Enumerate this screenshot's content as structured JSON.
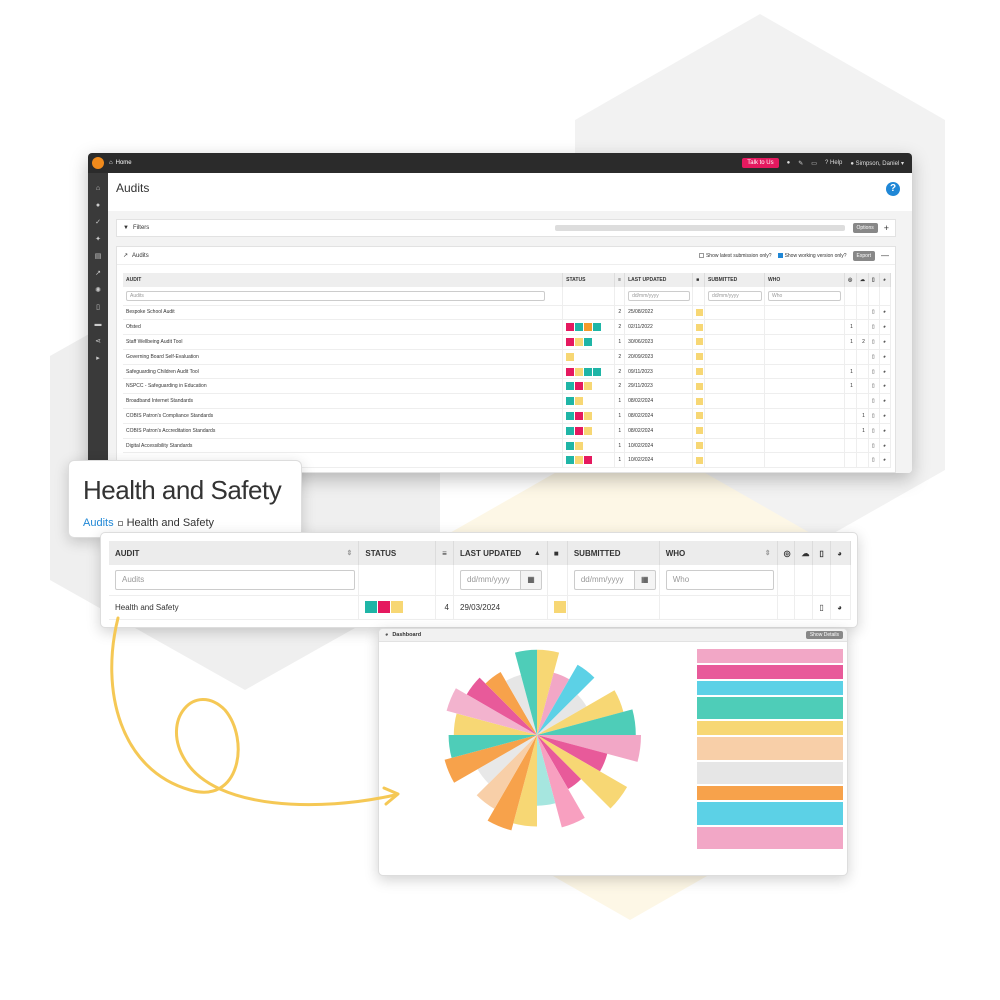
{
  "topbar": {
    "home_label": "Home",
    "talk_label": "Talk to Us",
    "help_label": "Help",
    "user_label": "Simpson, Daniel"
  },
  "page": {
    "title": "Audits"
  },
  "filters": {
    "label": "Filters",
    "options_label": "Options"
  },
  "audits_panel": {
    "label": "Audits",
    "latest_only_label": "Show latest submission only?",
    "working_version_label": "Show working version only?",
    "export_label": "Export",
    "columns": [
      "AUDIT",
      "STATUS",
      "LAST UPDATED",
      "SUBMITTED",
      "WHO"
    ],
    "filter_placeholders": {
      "audit": "Audits",
      "date": "dd/mm/yyyy",
      "who": "Who"
    },
    "rows": [
      {
        "name": "Bespoke School Audit",
        "status": [],
        "count": "2",
        "updated": "25/08/2022",
        "c1": "",
        "c2": ""
      },
      {
        "name": "Ofsted",
        "status": [
          "pink",
          "teal",
          "orange",
          "teal"
        ],
        "count": "2",
        "updated": "02/11/2022",
        "c1": "1",
        "c2": ""
      },
      {
        "name": "Staff Wellbeing Audit Tool",
        "status": [
          "pink",
          "yellow",
          "teal"
        ],
        "count": "1",
        "updated": "30/06/2023",
        "c1": "1",
        "c2": "2"
      },
      {
        "name": "Governing Board Self-Evaluation",
        "status": [
          "yellow"
        ],
        "count": "2",
        "updated": "20/09/2023",
        "c1": "",
        "c2": ""
      },
      {
        "name": "Safeguarding Children Audit Tool",
        "status": [
          "pink",
          "yellow",
          "teal",
          "teal"
        ],
        "count": "2",
        "updated": "09/11/2023",
        "c1": "1",
        "c2": ""
      },
      {
        "name": "NSPCC - Safeguarding in Education",
        "status": [
          "teal",
          "pink",
          "yellow"
        ],
        "count": "2",
        "updated": "29/11/2023",
        "c1": "1",
        "c2": ""
      },
      {
        "name": "Broadband Internet Standards",
        "status": [
          "teal",
          "yellow"
        ],
        "count": "1",
        "updated": "08/02/2024",
        "c1": "",
        "c2": ""
      },
      {
        "name": "COBIS Patron's Compliance Standards",
        "status": [
          "teal",
          "pink",
          "yellow"
        ],
        "count": "1",
        "updated": "08/02/2024",
        "c1": "",
        "c2": "1"
      },
      {
        "name": "COBIS Patron's Accreditation Standards",
        "status": [
          "teal",
          "pink",
          "yellow"
        ],
        "count": "1",
        "updated": "08/02/2024",
        "c1": "",
        "c2": "1"
      },
      {
        "name": "Digital Accessibility Standards",
        "status": [
          "teal",
          "yellow"
        ],
        "count": "1",
        "updated": "10/02/2024",
        "c1": "",
        "c2": ""
      },
      {
        "name": "",
        "status": [
          "teal",
          "yellow",
          "pink"
        ],
        "count": "1",
        "updated": "10/02/2024",
        "c1": "",
        "c2": ""
      }
    ]
  },
  "hs_card": {
    "title": "Health and Safety",
    "crumb_link": "Audits",
    "crumb_current": "Health and Safety"
  },
  "zoom_table": {
    "columns": {
      "audit": "AUDIT",
      "status": "STATUS",
      "last_updated": "LAST UPDATED",
      "submitted": "SUBMITTED",
      "who": "WHO"
    },
    "placeholders": {
      "audit": "Audits",
      "updated": "dd/mm/yyyy",
      "submitted": "dd/mm/yyyy",
      "who": "Who"
    },
    "row": {
      "name": "Health and Safety",
      "status": [
        "teal",
        "pink",
        "yellow"
      ],
      "count": "4",
      "updated": "29/03/2024"
    }
  },
  "dashboard": {
    "title": "Dashboard",
    "show_details_label": "Show Details",
    "wedges": [
      {
        "len": 0.82,
        "color": "#f7d774"
      },
      {
        "len": 0.62,
        "color": "#f2a7c6"
      },
      {
        "len": 0.78,
        "color": "#5cd1e6"
      },
      {
        "len": 0.55,
        "color": "#e6e6e6"
      },
      {
        "len": 0.86,
        "color": "#f7d774"
      },
      {
        "len": 0.95,
        "color": "#4ecdb8"
      },
      {
        "len": 1.0,
        "color": "#f2a7c6"
      },
      {
        "len": 0.7,
        "color": "#e85a9a"
      },
      {
        "len": 1.0,
        "color": "#f7d774"
      },
      {
        "len": 0.6,
        "color": "#e85a9a"
      },
      {
        "len": 0.92,
        "color": "#f8a0c0"
      },
      {
        "len": 0.68,
        "color": "#a6e6df"
      },
      {
        "len": 0.88,
        "color": "#f7d774"
      },
      {
        "len": 0.95,
        "color": "#f7a24b"
      },
      {
        "len": 0.82,
        "color": "#f8cfa8"
      },
      {
        "len": 0.66,
        "color": "#e8e8e8"
      },
      {
        "len": 0.92,
        "color": "#f7a24b"
      },
      {
        "len": 0.85,
        "color": "#4ecdb8"
      },
      {
        "len": 0.8,
        "color": "#f7d774"
      },
      {
        "len": 0.9,
        "color": "#f3b3ce"
      },
      {
        "len": 0.78,
        "color": "#e85a9a"
      },
      {
        "len": 0.7,
        "color": "#f7a24b"
      },
      {
        "len": 0.6,
        "color": "#e6e6e6"
      },
      {
        "len": 0.82,
        "color": "#4ecdb8"
      }
    ],
    "legend": [
      {
        "color": "#f2a7c6",
        "h": 0.5
      },
      {
        "color": "#e85a9a",
        "h": 0.5
      },
      {
        "color": "#5cd1e6",
        "h": 0.5
      },
      {
        "color": "#4ecdb8",
        "h": 0.8
      },
      {
        "color": "#f7d774",
        "h": 0.5
      },
      {
        "color": "#f8cfa8",
        "h": 0.8
      },
      {
        "color": "#e6e6e6",
        "h": 0.8
      },
      {
        "color": "#f7a24b",
        "h": 0.5
      },
      {
        "color": "#5cd1e6",
        "h": 0.8
      },
      {
        "color": "#f2a7c6",
        "h": 0.8
      }
    ]
  },
  "colors": {
    "teal": "#1fb5a6",
    "pink": "#e5195f",
    "yellow": "#f7d774",
    "orange": "#f39a2b",
    "accent": "#1f87d6"
  }
}
